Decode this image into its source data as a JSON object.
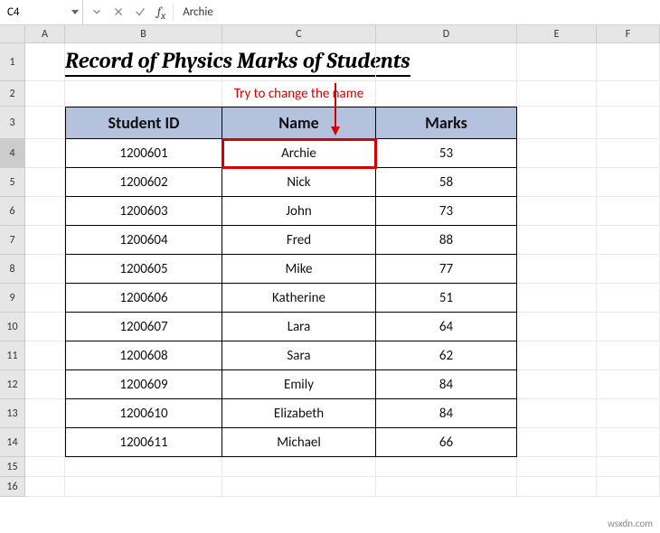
{
  "app": {
    "name_box": "C4",
    "formula": "Archie"
  },
  "cols": [
    "A",
    "B",
    "C",
    "D",
    "E",
    "F"
  ],
  "row_labels": [
    "1",
    "2",
    "3",
    "4",
    "5",
    "6",
    "7",
    "8",
    "9",
    "10",
    "11",
    "12",
    "13",
    "14",
    "15",
    "16"
  ],
  "title": "Record of Physics Marks of Students",
  "annotation": "Try to change the name",
  "table": {
    "headers": {
      "id": "Student ID",
      "name": "Name",
      "marks": "Marks"
    },
    "rows": [
      {
        "id": "1200601",
        "name": "Archie",
        "marks": "53"
      },
      {
        "id": "1200602",
        "name": "Nick",
        "marks": "58"
      },
      {
        "id": "1200603",
        "name": "John",
        "marks": "73"
      },
      {
        "id": "1200604",
        "name": "Fred",
        "marks": "88"
      },
      {
        "id": "1200605",
        "name": "Mike",
        "marks": "77"
      },
      {
        "id": "1200606",
        "name": "Katherine",
        "marks": "51"
      },
      {
        "id": "1200607",
        "name": "Lara",
        "marks": "64"
      },
      {
        "id": "1200608",
        "name": "Sara",
        "marks": "62"
      },
      {
        "id": "1200609",
        "name": "Emily",
        "marks": "84"
      },
      {
        "id": "1200610",
        "name": "Elizabeth",
        "marks": "84"
      },
      {
        "id": "1200611",
        "name": "Michael",
        "marks": "66"
      }
    ]
  },
  "watermark": "wsxdn.com"
}
